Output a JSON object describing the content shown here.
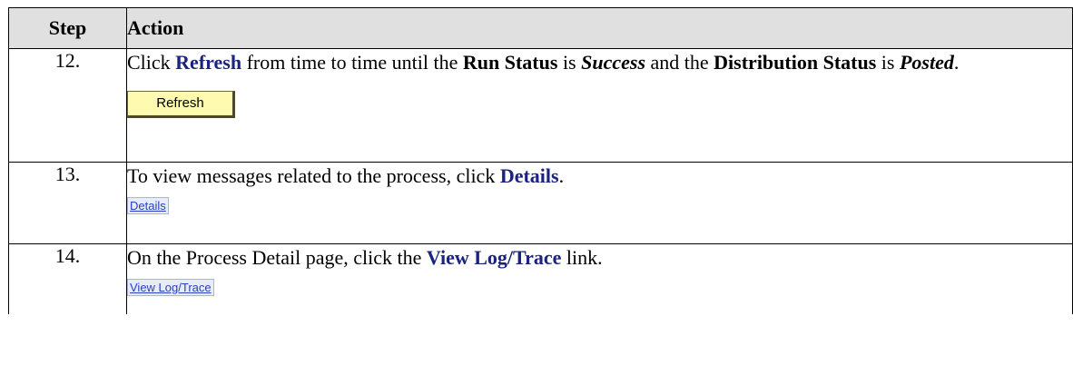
{
  "table": {
    "headers": {
      "step": "Step",
      "action": "Action"
    },
    "rows": [
      {
        "step": "12.",
        "text": {
          "p1": "Click ",
          "refresh_kw": "Refresh",
          "p2": " from time to time until the ",
          "run_status": "Run Status",
          "p3": " is ",
          "success": "Success",
          "p4": " and the ",
          "distribution": "Distribution Status",
          "p5": " is ",
          "posted": "Posted",
          "p6": "."
        },
        "button_label": "Refresh"
      },
      {
        "step": "13.",
        "text": {
          "p1": "To view messages related to the process, click ",
          "details_kw": "Details",
          "p2": "."
        },
        "link_label": "Details"
      },
      {
        "step": "14.",
        "text": {
          "p1": "On the Process Detail page, click the ",
          "viewlog_kw": "View Log/Trace",
          "p2": " link."
        },
        "link_label": "View Log/Trace"
      }
    ]
  },
  "colors": {
    "keyword": "#1a237e",
    "header_bg": "#e0e0e0",
    "button_bg": "#fefbb0",
    "link": "#2a41c0"
  }
}
